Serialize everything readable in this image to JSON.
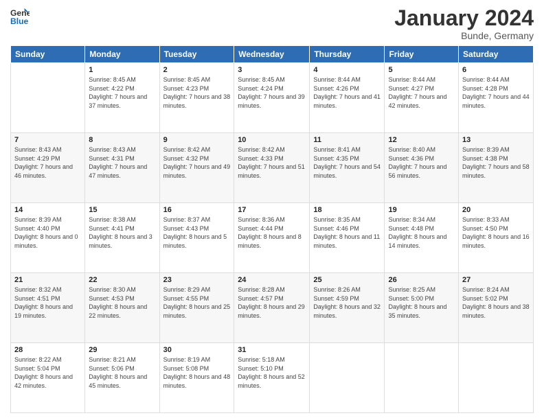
{
  "header": {
    "logo_line1": "General",
    "logo_line2": "Blue",
    "month": "January 2024",
    "location": "Bunde, Germany"
  },
  "weekdays": [
    "Sunday",
    "Monday",
    "Tuesday",
    "Wednesday",
    "Thursday",
    "Friday",
    "Saturday"
  ],
  "weeks": [
    [
      {
        "day": "",
        "sunrise": "",
        "sunset": "",
        "daylight": ""
      },
      {
        "day": "1",
        "sunrise": "Sunrise: 8:45 AM",
        "sunset": "Sunset: 4:22 PM",
        "daylight": "Daylight: 7 hours and 37 minutes."
      },
      {
        "day": "2",
        "sunrise": "Sunrise: 8:45 AM",
        "sunset": "Sunset: 4:23 PM",
        "daylight": "Daylight: 7 hours and 38 minutes."
      },
      {
        "day": "3",
        "sunrise": "Sunrise: 8:45 AM",
        "sunset": "Sunset: 4:24 PM",
        "daylight": "Daylight: 7 hours and 39 minutes."
      },
      {
        "day": "4",
        "sunrise": "Sunrise: 8:44 AM",
        "sunset": "Sunset: 4:26 PM",
        "daylight": "Daylight: 7 hours and 41 minutes."
      },
      {
        "day": "5",
        "sunrise": "Sunrise: 8:44 AM",
        "sunset": "Sunset: 4:27 PM",
        "daylight": "Daylight: 7 hours and 42 minutes."
      },
      {
        "day": "6",
        "sunrise": "Sunrise: 8:44 AM",
        "sunset": "Sunset: 4:28 PM",
        "daylight": "Daylight: 7 hours and 44 minutes."
      }
    ],
    [
      {
        "day": "7",
        "sunrise": "Sunrise: 8:43 AM",
        "sunset": "Sunset: 4:29 PM",
        "daylight": "Daylight: 7 hours and 46 minutes."
      },
      {
        "day": "8",
        "sunrise": "Sunrise: 8:43 AM",
        "sunset": "Sunset: 4:31 PM",
        "daylight": "Daylight: 7 hours and 47 minutes."
      },
      {
        "day": "9",
        "sunrise": "Sunrise: 8:42 AM",
        "sunset": "Sunset: 4:32 PM",
        "daylight": "Daylight: 7 hours and 49 minutes."
      },
      {
        "day": "10",
        "sunrise": "Sunrise: 8:42 AM",
        "sunset": "Sunset: 4:33 PM",
        "daylight": "Daylight: 7 hours and 51 minutes."
      },
      {
        "day": "11",
        "sunrise": "Sunrise: 8:41 AM",
        "sunset": "Sunset: 4:35 PM",
        "daylight": "Daylight: 7 hours and 54 minutes."
      },
      {
        "day": "12",
        "sunrise": "Sunrise: 8:40 AM",
        "sunset": "Sunset: 4:36 PM",
        "daylight": "Daylight: 7 hours and 56 minutes."
      },
      {
        "day": "13",
        "sunrise": "Sunrise: 8:39 AM",
        "sunset": "Sunset: 4:38 PM",
        "daylight": "Daylight: 7 hours and 58 minutes."
      }
    ],
    [
      {
        "day": "14",
        "sunrise": "Sunrise: 8:39 AM",
        "sunset": "Sunset: 4:40 PM",
        "daylight": "Daylight: 8 hours and 0 minutes."
      },
      {
        "day": "15",
        "sunrise": "Sunrise: 8:38 AM",
        "sunset": "Sunset: 4:41 PM",
        "daylight": "Daylight: 8 hours and 3 minutes."
      },
      {
        "day": "16",
        "sunrise": "Sunrise: 8:37 AM",
        "sunset": "Sunset: 4:43 PM",
        "daylight": "Daylight: 8 hours and 5 minutes."
      },
      {
        "day": "17",
        "sunrise": "Sunrise: 8:36 AM",
        "sunset": "Sunset: 4:44 PM",
        "daylight": "Daylight: 8 hours and 8 minutes."
      },
      {
        "day": "18",
        "sunrise": "Sunrise: 8:35 AM",
        "sunset": "Sunset: 4:46 PM",
        "daylight": "Daylight: 8 hours and 11 minutes."
      },
      {
        "day": "19",
        "sunrise": "Sunrise: 8:34 AM",
        "sunset": "Sunset: 4:48 PM",
        "daylight": "Daylight: 8 hours and 14 minutes."
      },
      {
        "day": "20",
        "sunrise": "Sunrise: 8:33 AM",
        "sunset": "Sunset: 4:50 PM",
        "daylight": "Daylight: 8 hours and 16 minutes."
      }
    ],
    [
      {
        "day": "21",
        "sunrise": "Sunrise: 8:32 AM",
        "sunset": "Sunset: 4:51 PM",
        "daylight": "Daylight: 8 hours and 19 minutes."
      },
      {
        "day": "22",
        "sunrise": "Sunrise: 8:30 AM",
        "sunset": "Sunset: 4:53 PM",
        "daylight": "Daylight: 8 hours and 22 minutes."
      },
      {
        "day": "23",
        "sunrise": "Sunrise: 8:29 AM",
        "sunset": "Sunset: 4:55 PM",
        "daylight": "Daylight: 8 hours and 25 minutes."
      },
      {
        "day": "24",
        "sunrise": "Sunrise: 8:28 AM",
        "sunset": "Sunset: 4:57 PM",
        "daylight": "Daylight: 8 hours and 29 minutes."
      },
      {
        "day": "25",
        "sunrise": "Sunrise: 8:26 AM",
        "sunset": "Sunset: 4:59 PM",
        "daylight": "Daylight: 8 hours and 32 minutes."
      },
      {
        "day": "26",
        "sunrise": "Sunrise: 8:25 AM",
        "sunset": "Sunset: 5:00 PM",
        "daylight": "Daylight: 8 hours and 35 minutes."
      },
      {
        "day": "27",
        "sunrise": "Sunrise: 8:24 AM",
        "sunset": "Sunset: 5:02 PM",
        "daylight": "Daylight: 8 hours and 38 minutes."
      }
    ],
    [
      {
        "day": "28",
        "sunrise": "Sunrise: 8:22 AM",
        "sunset": "Sunset: 5:04 PM",
        "daylight": "Daylight: 8 hours and 42 minutes."
      },
      {
        "day": "29",
        "sunrise": "Sunrise: 8:21 AM",
        "sunset": "Sunset: 5:06 PM",
        "daylight": "Daylight: 8 hours and 45 minutes."
      },
      {
        "day": "30",
        "sunrise": "Sunrise: 8:19 AM",
        "sunset": "Sunset: 5:08 PM",
        "daylight": "Daylight: 8 hours and 48 minutes."
      },
      {
        "day": "31",
        "sunrise": "Sunrise: 5:18 AM",
        "sunset": "Sunset: 5:10 PM",
        "daylight": "Daylight: 8 hours and 52 minutes."
      },
      {
        "day": "",
        "sunrise": "",
        "sunset": "",
        "daylight": ""
      },
      {
        "day": "",
        "sunrise": "",
        "sunset": "",
        "daylight": ""
      },
      {
        "day": "",
        "sunrise": "",
        "sunset": "",
        "daylight": ""
      }
    ]
  ]
}
